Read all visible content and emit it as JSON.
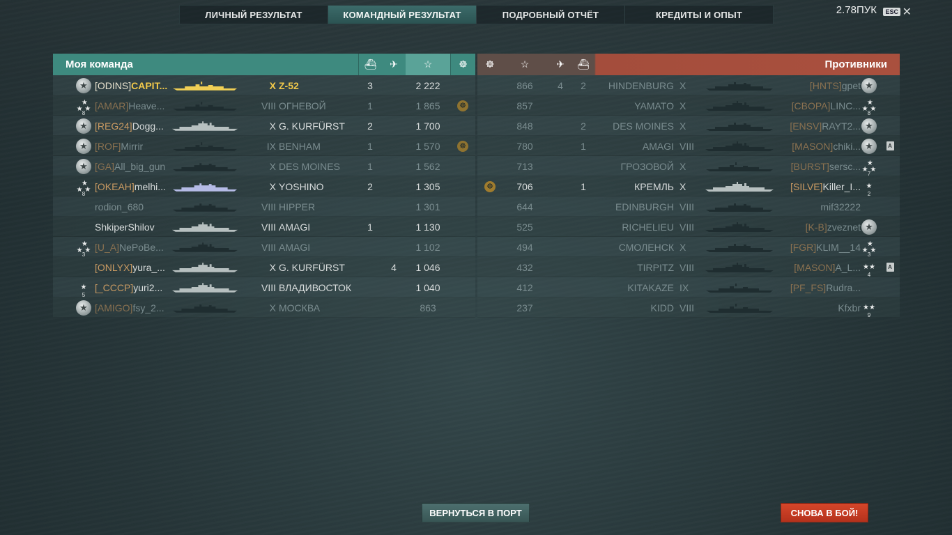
{
  "tabs": [
    {
      "label": "ЛИЧНЫЙ РЕЗУЛЬТАТ",
      "active": false
    },
    {
      "label": "КОМАНДНЫЙ РЕЗУЛЬТАТ",
      "active": true
    },
    {
      "label": "ПОДРОБНЫЙ ОТЧЁТ",
      "active": false
    },
    {
      "label": "КРЕДИТЫ И ОПЫТ",
      "active": false
    }
  ],
  "wallet": "2.78ПУК",
  "esc_label": "ESC",
  "close_glyph": "✕",
  "headers": {
    "my_team": "Моя команда",
    "enemies": "Противники",
    "icons": {
      "ships_destroyed": "ship-sunk-icon",
      "planes": "plane-shot-icon",
      "xp": "star-icon",
      "achievements": "medal-icon"
    }
  },
  "header_glyphs": {
    "ship": "⛴",
    "plane": "✈",
    "star": "☆",
    "medal": "☸"
  },
  "my_team": [
    {
      "rank": "medal",
      "rank_num": "",
      "tag": "[ODINS]",
      "name": "CAPIT...",
      "tier": "X",
      "ship": "Z-52",
      "kills": "3",
      "planes": "",
      "xp": "2 222",
      "achv": false,
      "dead": false,
      "me": true,
      "silh": "destroyer"
    },
    {
      "rank": "stars",
      "rank_num": "8",
      "tag": "[AMAR]",
      "name": "Heave...",
      "tier": "VIII",
      "ship": "ОГНЕВОЙ",
      "kills": "1",
      "planes": "",
      "xp": "1 865",
      "achv": true,
      "dead": true,
      "me": false,
      "silh": "destroyer"
    },
    {
      "rank": "medal",
      "rank_num": "",
      "tag": "[REG24]",
      "name": "Dogg...",
      "tier": "X",
      "ship": "G. KURFÜRST",
      "kills": "2",
      "planes": "",
      "xp": "1 700",
      "achv": false,
      "dead": false,
      "me": false,
      "silh": "battleship"
    },
    {
      "rank": "medal",
      "rank_num": "",
      "tag": "[ROF]",
      "name": "Mirrir",
      "tier": "IX",
      "ship": "BENHAM",
      "kills": "1",
      "planes": "",
      "xp": "1 570",
      "achv": true,
      "dead": true,
      "me": false,
      "silh": "destroyer"
    },
    {
      "rank": "medal",
      "rank_num": "",
      "tag": "[GA]",
      "name": "All_big_gun",
      "tier": "X",
      "ship": "DES MOINES",
      "kills": "1",
      "planes": "",
      "xp": "1 562",
      "achv": false,
      "dead": true,
      "me": false,
      "silh": "cruiser"
    },
    {
      "rank": "stars",
      "rank_num": "8",
      "tag": "[OKEAH]",
      "name": "melhi...",
      "tier": "X",
      "ship": "YOSHINO",
      "kills": "2",
      "planes": "",
      "xp": "1 305",
      "achv": false,
      "dead": false,
      "me": false,
      "silh": "cruiser-blue"
    },
    {
      "rank": "",
      "rank_num": "",
      "tag": "",
      "name": "rodion_680",
      "tier": "VIII",
      "ship": "HIPPER",
      "kills": "",
      "planes": "",
      "xp": "1 301",
      "achv": false,
      "dead": true,
      "me": false,
      "silh": "cruiser"
    },
    {
      "rank": "",
      "rank_num": "",
      "tag": "",
      "name": "ShkiperShilov",
      "tier": "VIII",
      "ship": "AMAGI",
      "kills": "1",
      "planes": "",
      "xp": "1 130",
      "achv": false,
      "dead": false,
      "me": false,
      "silh": "battleship"
    },
    {
      "rank": "stars",
      "rank_num": "3",
      "tag": "[U_A]",
      "name": "NePoBe...",
      "tier": "VIII",
      "ship": "AMAGI",
      "kills": "",
      "planes": "",
      "xp": "1 102",
      "achv": false,
      "dead": true,
      "me": false,
      "silh": "battleship"
    },
    {
      "rank": "",
      "rank_num": "",
      "tag": "[ONLYX]",
      "name": "yura_...",
      "tier": "X",
      "ship": "G. KURFÜRST",
      "kills": "",
      "planes": "4",
      "xp": "1 046",
      "achv": false,
      "dead": false,
      "me": false,
      "silh": "battleship"
    },
    {
      "rank": "stars1",
      "rank_num": "5",
      "tag": "[_CCCP]",
      "name": "yuri2...",
      "tier": "VIII",
      "ship": "ВЛАДИВОСТОК",
      "kills": "",
      "planes": "",
      "xp": "1 040",
      "achv": false,
      "dead": false,
      "me": false,
      "silh": "battleship"
    },
    {
      "rank": "medal",
      "rank_num": "",
      "tag": "[AMIGO]",
      "name": "fsy_2...",
      "tier": "X",
      "ship": "МОСКВА",
      "kills": "",
      "planes": "",
      "xp": "863",
      "achv": false,
      "dead": true,
      "me": false,
      "silh": "cruiser"
    }
  ],
  "enemies": [
    {
      "achv": false,
      "xp": "866",
      "planes": "4",
      "kills": "2",
      "ship": "HINDENBURG",
      "tier": "X",
      "tag": "[HNTS]",
      "name": "gpet",
      "rank": "medal",
      "rank_num": "",
      "div": false,
      "dead": true,
      "silh": "cruiser"
    },
    {
      "achv": false,
      "xp": "857",
      "planes": "",
      "kills": "",
      "ship": "YAMATO",
      "tier": "X",
      "tag": "[CBOPA]",
      "name": "LINC...",
      "rank": "stars",
      "rank_num": "8",
      "div": false,
      "dead": true,
      "silh": "battleship"
    },
    {
      "achv": false,
      "xp": "848",
      "planes": "",
      "kills": "2",
      "ship": "DES MOINES",
      "tier": "X",
      "tag": "[ENSV]",
      "name": "RAYT2...",
      "rank": "medal",
      "rank_num": "",
      "div": false,
      "dead": true,
      "silh": "cruiser"
    },
    {
      "achv": false,
      "xp": "780",
      "planes": "",
      "kills": "1",
      "ship": "AMAGI",
      "tier": "VIII",
      "tag": "[MASON]",
      "name": "chiki...",
      "rank": "medal",
      "rank_num": "",
      "div": true,
      "dead": true,
      "silh": "battleship"
    },
    {
      "achv": false,
      "xp": "713",
      "planes": "",
      "kills": "",
      "ship": "ГРОЗОВОЙ",
      "tier": "X",
      "tag": "[BURST]",
      "name": "sersc...",
      "rank": "stars",
      "rank_num": "7",
      "div": false,
      "dead": true,
      "silh": "destroyer"
    },
    {
      "achv": true,
      "xp": "706",
      "planes": "",
      "kills": "1",
      "ship": "КРЕМЛЬ",
      "tier": "X",
      "tag": "[SILVE]",
      "name": "Killer_I...",
      "rank": "stars1",
      "rank_num": "2",
      "div": false,
      "dead": false,
      "silh": "battleship"
    },
    {
      "achv": false,
      "xp": "644",
      "planes": "",
      "kills": "",
      "ship": "EDINBURGH",
      "tier": "VIII",
      "tag": "",
      "name": "mif32222",
      "rank": "",
      "rank_num": "",
      "div": false,
      "dead": true,
      "silh": "cruiser"
    },
    {
      "achv": false,
      "xp": "525",
      "planes": "",
      "kills": "",
      "ship": "RICHELIEU",
      "tier": "VIII",
      "tag": "[K-B]",
      "name": "zveznet",
      "rank": "medal",
      "rank_num": "",
      "div": false,
      "dead": true,
      "silh": "battleship"
    },
    {
      "achv": false,
      "xp": "494",
      "planes": "",
      "kills": "",
      "ship": "СМОЛЕНСК",
      "tier": "X",
      "tag": "[FGR]",
      "name": "KLIM__14",
      "rank": "stars",
      "rank_num": "3",
      "div": false,
      "dead": true,
      "silh": "cruiser"
    },
    {
      "achv": false,
      "xp": "432",
      "planes": "",
      "kills": "",
      "ship": "TIRPITZ",
      "tier": "VIII",
      "tag": "[MASON]",
      "name": "A_L...",
      "rank": "stars2",
      "rank_num": "4",
      "div": true,
      "dead": true,
      "silh": "battleship"
    },
    {
      "achv": false,
      "xp": "412",
      "planes": "",
      "kills": "",
      "ship": "KITAKAZE",
      "tier": "IX",
      "tag": "[PF_FS]",
      "name": "Rudra...",
      "rank": "",
      "rank_num": "",
      "div": false,
      "dead": true,
      "silh": "destroyer"
    },
    {
      "achv": false,
      "xp": "237",
      "planes": "",
      "kills": "",
      "ship": "KIDD",
      "tier": "VIII",
      "tag": "",
      "name": "Kfxbr",
      "rank": "stars2",
      "rank_num": "9",
      "div": false,
      "dead": true,
      "silh": "destroyer"
    }
  ],
  "div_letter": "A",
  "achv_glyph": "☸",
  "buttons": {
    "port": "ВЕРНУТЬСЯ В ПОРТ",
    "battle": "СНОВА В БОЙ!"
  },
  "colors": {
    "team_header": "#3e8a7f",
    "enemy_header": "#a9503e",
    "battle_button": "#c83c22",
    "me_highlight": "#f0c84a",
    "clan_tag": "#c99a62"
  }
}
